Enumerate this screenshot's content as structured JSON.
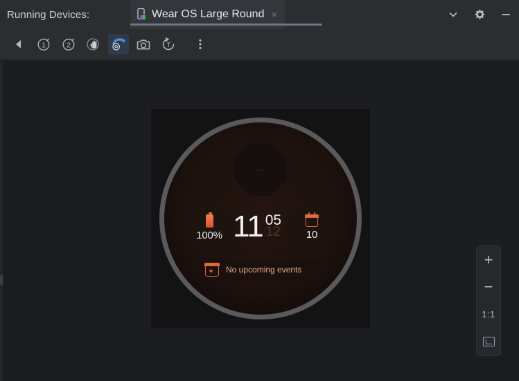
{
  "window": {
    "label": "Running Devices:",
    "controls": [
      {
        "name": "chevron-down",
        "icon": "chevron-down-icon"
      },
      {
        "name": "settings",
        "icon": "gear-icon"
      },
      {
        "name": "minimize",
        "icon": "minimize-icon"
      }
    ]
  },
  "tab": {
    "title": "Wear OS Large Round",
    "close_label": "×",
    "device_icon": "device-icon"
  },
  "toolbar": {
    "buttons": [
      {
        "name": "back-button",
        "icon": "back-arrow-icon",
        "label": "Back",
        "selected": false
      },
      {
        "name": "button-1",
        "icon": "circled-1-icon",
        "label": "1",
        "selected": false
      },
      {
        "name": "button-2",
        "icon": "circled-2-icon",
        "label": "2",
        "selected": false
      },
      {
        "name": "palm-button",
        "icon": "palm-icon",
        "label": "Palm",
        "selected": false
      },
      {
        "name": "rotate-wrist-button",
        "icon": "tilt-icon",
        "label": "Tilt",
        "selected": true
      },
      {
        "name": "screenshot-button",
        "icon": "camera-icon",
        "label": "Screenshot",
        "selected": false
      },
      {
        "name": "rotate-button",
        "icon": "rotate-icon",
        "label": "Rotate",
        "selected": false
      },
      {
        "name": "more-button",
        "icon": "more-vertical-icon",
        "label": "More",
        "selected": false
      }
    ]
  },
  "watchface": {
    "complication_top": {
      "placeholder": "--"
    },
    "complication_left": {
      "icon": "battery-icon",
      "value": "100%"
    },
    "complication_right": {
      "icon": "calendar-icon",
      "value": "10"
    },
    "time": {
      "hour": "11",
      "minute": "05",
      "minute_ghost": "12"
    },
    "events": {
      "icon": "calendar-heart-icon",
      "text": "No upcoming events"
    }
  },
  "zoom_controls": {
    "zoom_in": "+",
    "zoom_out": "−",
    "actual_size": "1:1",
    "fit_to_window": "fit-icon"
  },
  "colors": {
    "background": "#1b1d21",
    "chrome": "#2b2d30",
    "tab_active": "#34363b",
    "accent_orange": "#e1673c",
    "selected_tool": "#2f3a4a",
    "bezel": "#5a5a5c"
  }
}
